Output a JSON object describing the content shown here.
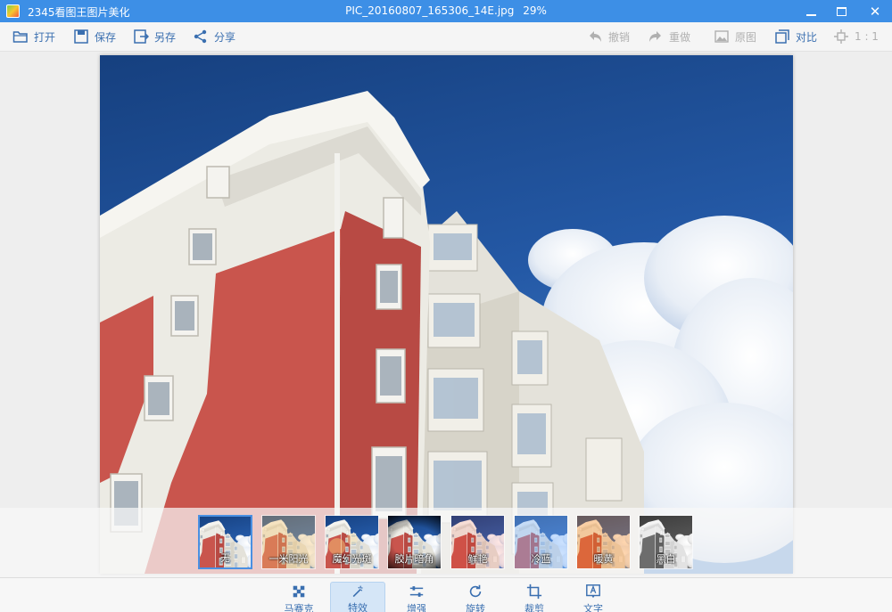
{
  "titlebar": {
    "app_name": "2345看图王图片美化",
    "file_name": "PIC_20160807_165306_14E.jpg",
    "zoom": "29%"
  },
  "toolbar": {
    "left": [
      {
        "label": "打开",
        "icon": "folder-open-icon"
      },
      {
        "label": "保存",
        "icon": "save-icon"
      },
      {
        "label": "另存",
        "icon": "save-as-icon"
      },
      {
        "label": "分享",
        "icon": "share-icon"
      }
    ],
    "right": [
      {
        "label": "撤销",
        "icon": "undo-icon"
      },
      {
        "label": "重做",
        "icon": "redo-icon"
      },
      {
        "label": "原图",
        "icon": "original-image-icon"
      },
      {
        "label": "对比",
        "icon": "compare-icon"
      },
      {
        "label": "1 : 1",
        "icon": "actual-size-icon"
      }
    ]
  },
  "filters": {
    "selected_index": 0,
    "items": [
      {
        "label": "无"
      },
      {
        "label": "一米阳光"
      },
      {
        "label": "魔幻光斑"
      },
      {
        "label": "胶片暗角"
      },
      {
        "label": "鲜艳"
      },
      {
        "label": "冷蓝"
      },
      {
        "label": "暖黄"
      },
      {
        "label": "黑白"
      }
    ]
  },
  "bottom_tabs": {
    "active_index": 1,
    "items": [
      {
        "label": "马赛克",
        "icon": "mosaic-icon"
      },
      {
        "label": "特效",
        "icon": "magic-wand-icon"
      },
      {
        "label": "增强",
        "icon": "sliders-icon"
      },
      {
        "label": "旋转",
        "icon": "rotate-icon"
      },
      {
        "label": "裁剪",
        "icon": "crop-icon"
      },
      {
        "label": "文字",
        "icon": "text-icon"
      }
    ]
  },
  "colors": {
    "titlebar": "#3d8fe6",
    "accent": "#3a6fb0",
    "selected_border": "#4a90e2",
    "sky": "#1d4f9c",
    "wall_red": "#c9554d",
    "wall_white": "#ecebe4"
  }
}
